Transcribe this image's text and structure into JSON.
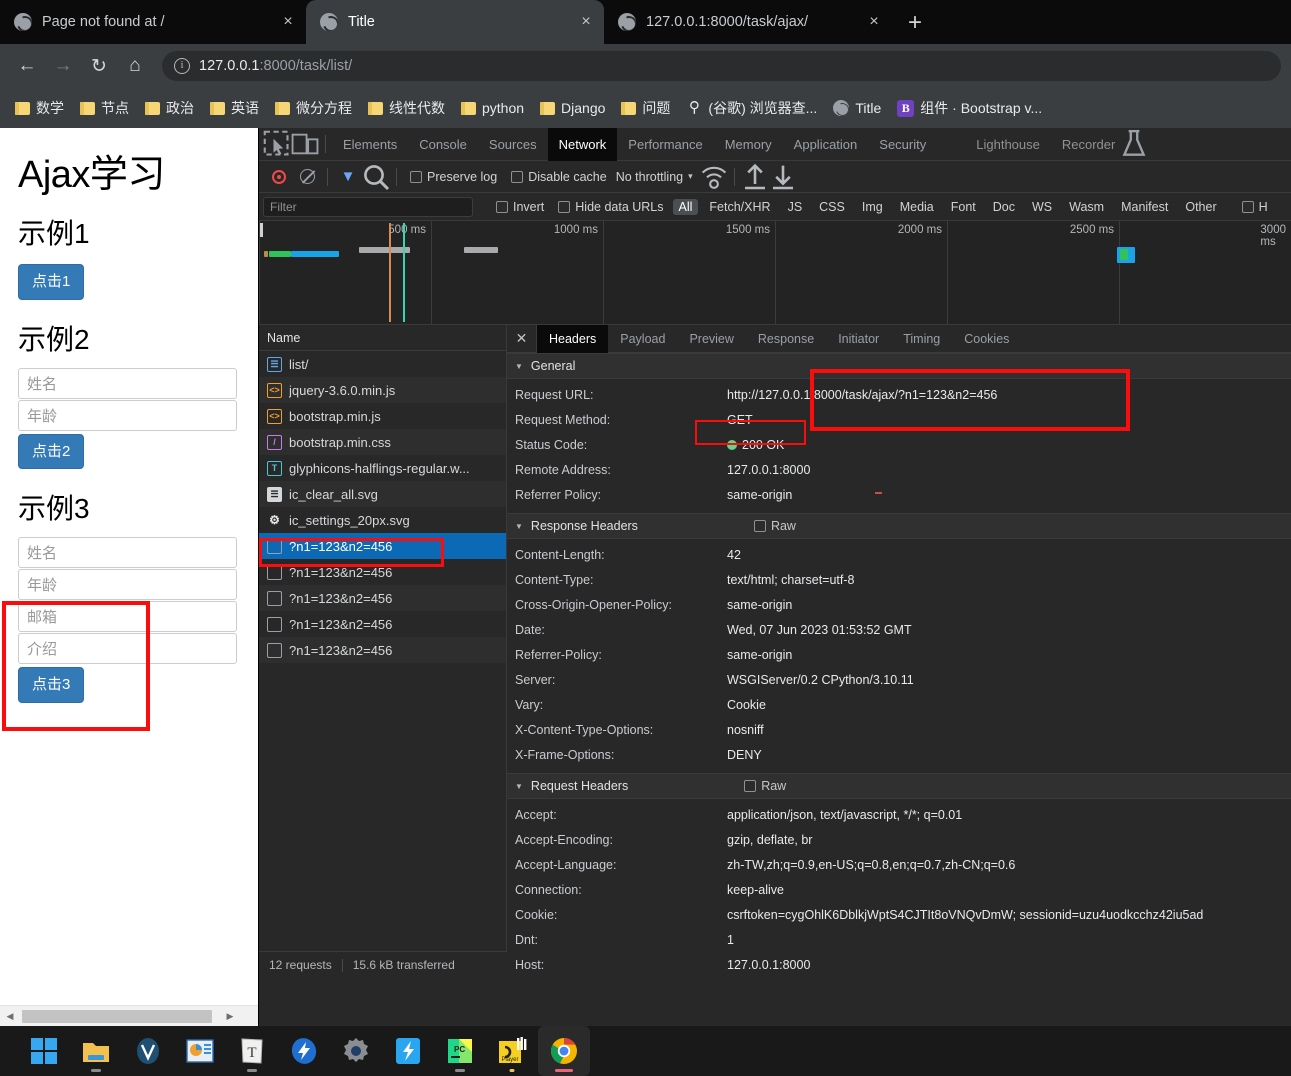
{
  "browser": {
    "tabs": [
      {
        "title": "Page not found at /",
        "active": false,
        "favicon": "globe-icon"
      },
      {
        "title": "Title",
        "active": true,
        "favicon": "globe-icon"
      },
      {
        "title": "127.0.0.1:8000/task/ajax/",
        "active": false,
        "favicon": "globe-icon"
      }
    ],
    "new_tab_label": "+",
    "close_label": "×",
    "nav": {
      "back": "←",
      "forward": "→",
      "reload": "↻",
      "home": "⌂",
      "info_icon": "i",
      "url_host": "127.0.0.1",
      "url_rest": ":8000/task/list/"
    },
    "bookmarks": [
      {
        "label": "数学",
        "icon": "folder-icon"
      },
      {
        "label": "节点",
        "icon": "folder-icon"
      },
      {
        "label": "政治",
        "icon": "folder-icon"
      },
      {
        "label": "英语",
        "icon": "folder-icon"
      },
      {
        "label": "微分方程",
        "icon": "folder-icon"
      },
      {
        "label": "线性代数",
        "icon": "folder-icon"
      },
      {
        "label": "python",
        "icon": "folder-icon"
      },
      {
        "label": "Django",
        "icon": "folder-icon"
      },
      {
        "label": "问题",
        "icon": "folder-icon"
      },
      {
        "label": "(谷歌) 浏览器查...",
        "icon": "search-icon"
      },
      {
        "label": "Title",
        "icon": "globe-icon"
      },
      {
        "label": "组件 · Bootstrap v...",
        "icon": "bootstrap-icon"
      }
    ]
  },
  "page": {
    "heading": "Ajax学习",
    "sections": [
      {
        "title": "示例1",
        "inputs": [],
        "button": "点击1"
      },
      {
        "title": "示例2",
        "inputs": [
          "姓名",
          "年龄"
        ],
        "button": "点击2"
      },
      {
        "title": "示例3",
        "inputs": [
          "姓名",
          "年龄",
          "邮箱",
          "介绍"
        ],
        "button": "点击3"
      }
    ]
  },
  "devtools": {
    "panel_tabs": [
      {
        "label": "Elements",
        "active": false
      },
      {
        "label": "Console",
        "active": false
      },
      {
        "label": "Sources",
        "active": false
      },
      {
        "label": "Network",
        "active": true
      },
      {
        "label": "Performance",
        "active": false
      },
      {
        "label": "Memory",
        "active": false
      },
      {
        "label": "Application",
        "active": false
      },
      {
        "label": "Security",
        "active": false
      },
      {
        "label": "Lighthouse",
        "active": false
      },
      {
        "label": "Recorder",
        "active": false
      }
    ],
    "toolbar": {
      "record_icon": "record-icon",
      "clear_icon": "clear-icon",
      "filter_icon": "funnel-icon",
      "search_icon": "search-icon",
      "preserve_log": "Preserve log",
      "disable_cache": "Disable cache",
      "throttling": "No throttling",
      "throttling_caret": "▾",
      "wifi_icon": "network-conditions-icon",
      "import_icon": "import-har-icon",
      "export_icon": "export-har-icon"
    },
    "filterbar": {
      "placeholder": "Filter",
      "invert": "Invert",
      "hide_data_urls": "Hide data URLs",
      "types": [
        "All",
        "Fetch/XHR",
        "JS",
        "CSS",
        "Img",
        "Media",
        "Font",
        "Doc",
        "WS",
        "Wasm",
        "Manifest",
        "Other"
      ],
      "selected_type": "All",
      "trailing_partial": "H"
    },
    "overview": {
      "ticks": [
        "500 ms",
        "1000 ms",
        "1500 ms",
        "2000 ms",
        "2500 ms",
        "3000 ms"
      ]
    },
    "requests": {
      "column_header": "Name",
      "rows": [
        {
          "name": "list/",
          "icon": "doc-icon",
          "type": "doc",
          "selected": false
        },
        {
          "name": "jquery-3.6.0.min.js",
          "icon": "js-icon",
          "type": "js",
          "selected": false
        },
        {
          "name": "bootstrap.min.js",
          "icon": "js-icon",
          "type": "js",
          "selected": false
        },
        {
          "name": "bootstrap.min.css",
          "icon": "css-icon",
          "type": "css",
          "selected": false
        },
        {
          "name": "glyphicons-halflings-regular.w...",
          "icon": "font-icon",
          "type": "font",
          "selected": false
        },
        {
          "name": "ic_clear_all.svg",
          "icon": "image-icon",
          "type": "img",
          "selected": false
        },
        {
          "name": "ic_settings_20px.svg",
          "icon": "gear-icon",
          "type": "img",
          "selected": false
        },
        {
          "name": "?n1=123&n2=456",
          "icon": "xhr-icon",
          "type": "xhr",
          "selected": true
        },
        {
          "name": "?n1=123&n2=456",
          "icon": "xhr-icon",
          "type": "xhr",
          "selected": false
        },
        {
          "name": "?n1=123&n2=456",
          "icon": "xhr-icon",
          "type": "xhr",
          "selected": false
        },
        {
          "name": "?n1=123&n2=456",
          "icon": "xhr-icon",
          "type": "xhr",
          "selected": false
        },
        {
          "name": "?n1=123&n2=456",
          "icon": "xhr-icon",
          "type": "xhr",
          "selected": false
        }
      ]
    },
    "detail_tabs": [
      {
        "label": "Headers",
        "active": true
      },
      {
        "label": "Payload",
        "active": false
      },
      {
        "label": "Preview",
        "active": false
      },
      {
        "label": "Response",
        "active": false
      },
      {
        "label": "Initiator",
        "active": false
      },
      {
        "label": "Timing",
        "active": false
      },
      {
        "label": "Cookies",
        "active": false
      }
    ],
    "close_detail": "✕",
    "general": {
      "title": "General",
      "rows": [
        {
          "k": "Request URL:",
          "v": "http://127.0.0.1:8000/task/ajax/?n1=123&n2=456"
        },
        {
          "k": "Request Method:",
          "v": "GET"
        },
        {
          "k": "Status Code:",
          "v": "200 OK",
          "dot": true
        },
        {
          "k": "Remote Address:",
          "v": "127.0.0.1:8000"
        },
        {
          "k": "Referrer Policy:",
          "v": "same-origin"
        }
      ]
    },
    "response_headers": {
      "title": "Response Headers",
      "raw_label": "Raw",
      "rows": [
        {
          "k": "Content-Length:",
          "v": "42"
        },
        {
          "k": "Content-Type:",
          "v": "text/html; charset=utf-8"
        },
        {
          "k": "Cross-Origin-Opener-Policy:",
          "v": "same-origin"
        },
        {
          "k": "Date:",
          "v": "Wed, 07 Jun 2023 01:53:52 GMT"
        },
        {
          "k": "Referrer-Policy:",
          "v": "same-origin"
        },
        {
          "k": "Server:",
          "v": "WSGIServer/0.2 CPython/3.10.11"
        },
        {
          "k": "Vary:",
          "v": "Cookie"
        },
        {
          "k": "X-Content-Type-Options:",
          "v": "nosniff"
        },
        {
          "k": "X-Frame-Options:",
          "v": "DENY"
        }
      ]
    },
    "request_headers": {
      "title": "Request Headers",
      "raw_label": "Raw",
      "rows": [
        {
          "k": "Accept:",
          "v": "application/json, text/javascript, */*; q=0.01"
        },
        {
          "k": "Accept-Encoding:",
          "v": "gzip, deflate, br"
        },
        {
          "k": "Accept-Language:",
          "v": "zh-TW,zh;q=0.9,en-US;q=0.8,en;q=0.7,zh-CN;q=0.6"
        },
        {
          "k": "Connection:",
          "v": "keep-alive"
        },
        {
          "k": "Cookie:",
          "v": "csrftoken=cygOhlK6DblkjWptS4CJTIt8oVNQvDmW; sessionid=uzu4uodkcchz42iu5ad"
        },
        {
          "k": "Dnt:",
          "v": "1"
        },
        {
          "k": "Host:",
          "v": "127.0.0.1:8000"
        }
      ]
    },
    "status": {
      "requests": "12 requests",
      "transferred": "15.6 kB transferred"
    }
  },
  "taskbar": {
    "items": [
      {
        "name": "start-button"
      },
      {
        "name": "file-explorer"
      },
      {
        "name": "vmware-player"
      },
      {
        "name": "presentation-app"
      },
      {
        "name": "typora"
      },
      {
        "name": "thunder-app"
      },
      {
        "name": "settings-app"
      },
      {
        "name": "snipaste-app"
      },
      {
        "name": "pycharm-app"
      },
      {
        "name": "potplayer-app"
      },
      {
        "name": "chrome-app"
      }
    ]
  },
  "annotations": {
    "highlight_color": "#fb0d0d"
  }
}
